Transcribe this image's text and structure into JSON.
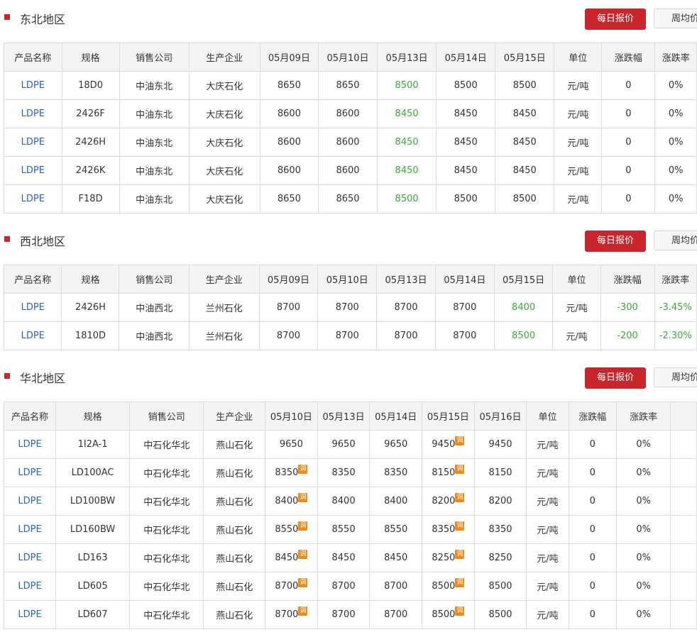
{
  "sections": [
    {
      "title": "东北地区",
      "daily_label": "每日报价",
      "weekly_label": "周均价",
      "headers": [
        "产品名称",
        "规格",
        "销售公司",
        "生产企业",
        "05月09日",
        "05月10日",
        "05月13日",
        "05月14日",
        "05月15日",
        "单位",
        "涨跌幅",
        "涨跌率"
      ],
      "rows": [
        {
          "name": "LDPE",
          "spec": "18D0",
          "seller": "中油东北",
          "producer": "大庆石化",
          "p1": "8650",
          "p2": "8650",
          "p3": "8500",
          "p4": "8500",
          "p5": "8500",
          "unit": "元/吨",
          "chg": "0",
          "rate": "0%"
        },
        {
          "name": "LDPE",
          "spec": "2426F",
          "seller": "中油东北",
          "producer": "大庆石化",
          "p1": "8600",
          "p2": "8600",
          "p3": "8450",
          "p4": "8450",
          "p5": "8450",
          "unit": "元/吨",
          "chg": "0",
          "rate": "0%"
        },
        {
          "name": "LDPE",
          "spec": "2426H",
          "seller": "中油东北",
          "producer": "大庆石化",
          "p1": "8600",
          "p2": "8600",
          "p3": "8450",
          "p4": "8450",
          "p5": "8450",
          "unit": "元/吨",
          "chg": "0",
          "rate": "0%"
        },
        {
          "name": "LDPE",
          "spec": "2426K",
          "seller": "中油东北",
          "producer": "大庆石化",
          "p1": "8600",
          "p2": "8600",
          "p3": "8450",
          "p4": "8450",
          "p5": "8450",
          "unit": "元/吨",
          "chg": "0",
          "rate": "0%"
        },
        {
          "name": "LDPE",
          "spec": "F18D",
          "seller": "中油东北",
          "producer": "大庆石化",
          "p1": "8650",
          "p2": "8650",
          "p3": "8500",
          "p4": "8500",
          "p5": "8500",
          "unit": "元/吨",
          "chg": "0",
          "rate": "0%"
        }
      ]
    },
    {
      "title": "西北地区",
      "daily_label": "每日报价",
      "weekly_label": "周均价",
      "headers": [
        "产品名称",
        "规格",
        "销售公司",
        "生产企业",
        "05月09日",
        "05月10日",
        "05月13日",
        "05月14日",
        "05月15日",
        "单位",
        "涨跌幅",
        "涨跌率"
      ],
      "rows": [
        {
          "name": "LDPE",
          "spec": "2426H",
          "seller": "中油西北",
          "producer": "兰州石化",
          "p1": "8700",
          "p2": "8700",
          "p3": "8700",
          "p4": "8700",
          "p5": "8400",
          "unit": "元/吨",
          "chg": "-300",
          "rate": "-3.45%"
        },
        {
          "name": "LDPE",
          "spec": "1810D",
          "seller": "中油西北",
          "producer": "兰州石化",
          "p1": "8700",
          "p2": "8700",
          "p3": "8700",
          "p4": "8700",
          "p5": "8500",
          "unit": "元/吨",
          "chg": "-200",
          "rate": "-2.30%"
        }
      ]
    },
    {
      "title": "华北地区",
      "daily_label": "每日报价",
      "weekly_label": "周均价",
      "adjust_badge": "调",
      "headers": [
        "产品名称",
        "规格",
        "销售公司",
        "生产企业",
        "05月10日",
        "05月13日",
        "05月14日",
        "05月15日",
        "05月16日",
        "单位",
        "涨跌幅",
        "涨跌率"
      ],
      "rows": [
        {
          "name": "LDPE",
          "spec": "1I2A-1",
          "seller": "中石化华北",
          "producer": "燕山石化",
          "p1": "9650",
          "p2": "9650",
          "p3": "9650",
          "p4": "9450",
          "p5": "9450",
          "unit": "元/吨",
          "chg": "0",
          "rate": "0%"
        },
        {
          "name": "LDPE",
          "spec": "LD100AC",
          "seller": "中石化华北",
          "producer": "燕山石化",
          "p1": "8350",
          "p2": "8350",
          "p3": "8350",
          "p4": "8150",
          "p5": "8150",
          "unit": "元/吨",
          "chg": "0",
          "rate": "0%"
        },
        {
          "name": "LDPE",
          "spec": "LD100BW",
          "seller": "中石化华北",
          "producer": "燕山石化",
          "p1": "8400",
          "p2": "8400",
          "p3": "8400",
          "p4": "8200",
          "p5": "8200",
          "unit": "元/吨",
          "chg": "0",
          "rate": "0%"
        },
        {
          "name": "LDPE",
          "spec": "LD160BW",
          "seller": "中石化华北",
          "producer": "燕山石化",
          "p1": "8550",
          "p2": "8550",
          "p3": "8550",
          "p4": "8350",
          "p5": "8350",
          "unit": "元/吨",
          "chg": "0",
          "rate": "0%"
        },
        {
          "name": "LDPE",
          "spec": "LD163",
          "seller": "中石化华北",
          "producer": "燕山石化",
          "p1": "8450",
          "p2": "8450",
          "p3": "8450",
          "p4": "8250",
          "p5": "8250",
          "unit": "元/吨",
          "chg": "0",
          "rate": "0%"
        },
        {
          "name": "LDPE",
          "spec": "LD605",
          "seller": "中石化华北",
          "producer": "燕山石化",
          "p1": "8700",
          "p2": "8700",
          "p3": "8700",
          "p4": "8500",
          "p5": "8500",
          "unit": "元/吨",
          "chg": "0",
          "rate": "0%"
        },
        {
          "name": "LDPE",
          "spec": "LD607",
          "seller": "中石化华北",
          "producer": "燕山石化",
          "p1": "8700",
          "p2": "8700",
          "p3": "8700",
          "p4": "8500",
          "p5": "8500",
          "unit": "元/吨",
          "chg": "0",
          "rate": "0%"
        }
      ]
    }
  ]
}
